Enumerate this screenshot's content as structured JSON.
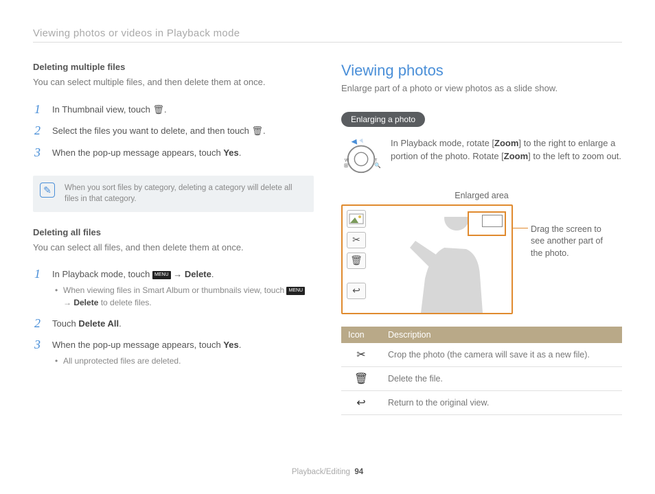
{
  "header": "Viewing photos or videos in Playback mode",
  "left": {
    "h1": "Deleting multiple files",
    "p1": "You can select multiple files, and then delete them at once.",
    "steps1": [
      {
        "pre": "In Thumbnail view, touch ",
        "icon": "🗑",
        "post": "."
      },
      {
        "pre": "Select the files you want to delete, and then touch ",
        "icon": "🗑",
        "post": "."
      },
      {
        "pre": "When the pop-up message appears, touch ",
        "bold": "Yes",
        "post": "."
      }
    ],
    "note": "When you sort files by category, deleting a category will delete all files in that category.",
    "h2": "Deleting all files",
    "p2": "You can select all files, and then delete them at once.",
    "steps2_1_pre": "In Playback mode, touch ",
    "steps2_1_menu": "MENU",
    "steps2_1_arrow": " → ",
    "steps2_1_bold": "Delete",
    "steps2_1_post": ".",
    "steps2_1_sub_pre": "When viewing files in Smart Album or thumbnails view, touch ",
    "steps2_1_sub_arrow": " → ",
    "steps2_1_sub_bold": "Delete",
    "steps2_1_sub_post": " to delete files.",
    "steps2_2_pre": "Touch ",
    "steps2_2_bold": "Delete All",
    "steps2_2_post": ".",
    "steps2_3_pre": "When the pop-up message appears, touch ",
    "steps2_3_bold": "Yes",
    "steps2_3_post": ".",
    "steps2_3_sub": "All unprotected files are deleted."
  },
  "right": {
    "title": "Viewing photos",
    "sub": "Enlarge part of a photo or view photos as a slide show.",
    "pill": "Enlarging a photo",
    "zoom_pre": "In Playback mode, rotate [",
    "zoom_b1": "Zoom",
    "zoom_mid1": "] to the right to enlarge a portion of the photo. Rotate [",
    "zoom_b2": "Zoom",
    "zoom_mid2": "] to the left to zoom out.",
    "enlarged_label": "Enlarged area",
    "drag": "Drag the screen to see another part of the photo.",
    "table": {
      "h1": "Icon",
      "h2": "Description",
      "rows": [
        {
          "icon": "✂",
          "desc": "Crop the photo (the camera will save it as a new file)."
        },
        {
          "icon": "🗑",
          "desc": "Delete the file."
        },
        {
          "icon": "↩",
          "desc": "Return to the original view."
        }
      ]
    }
  },
  "footer": {
    "section": "Playback/Editing",
    "page": "94"
  }
}
